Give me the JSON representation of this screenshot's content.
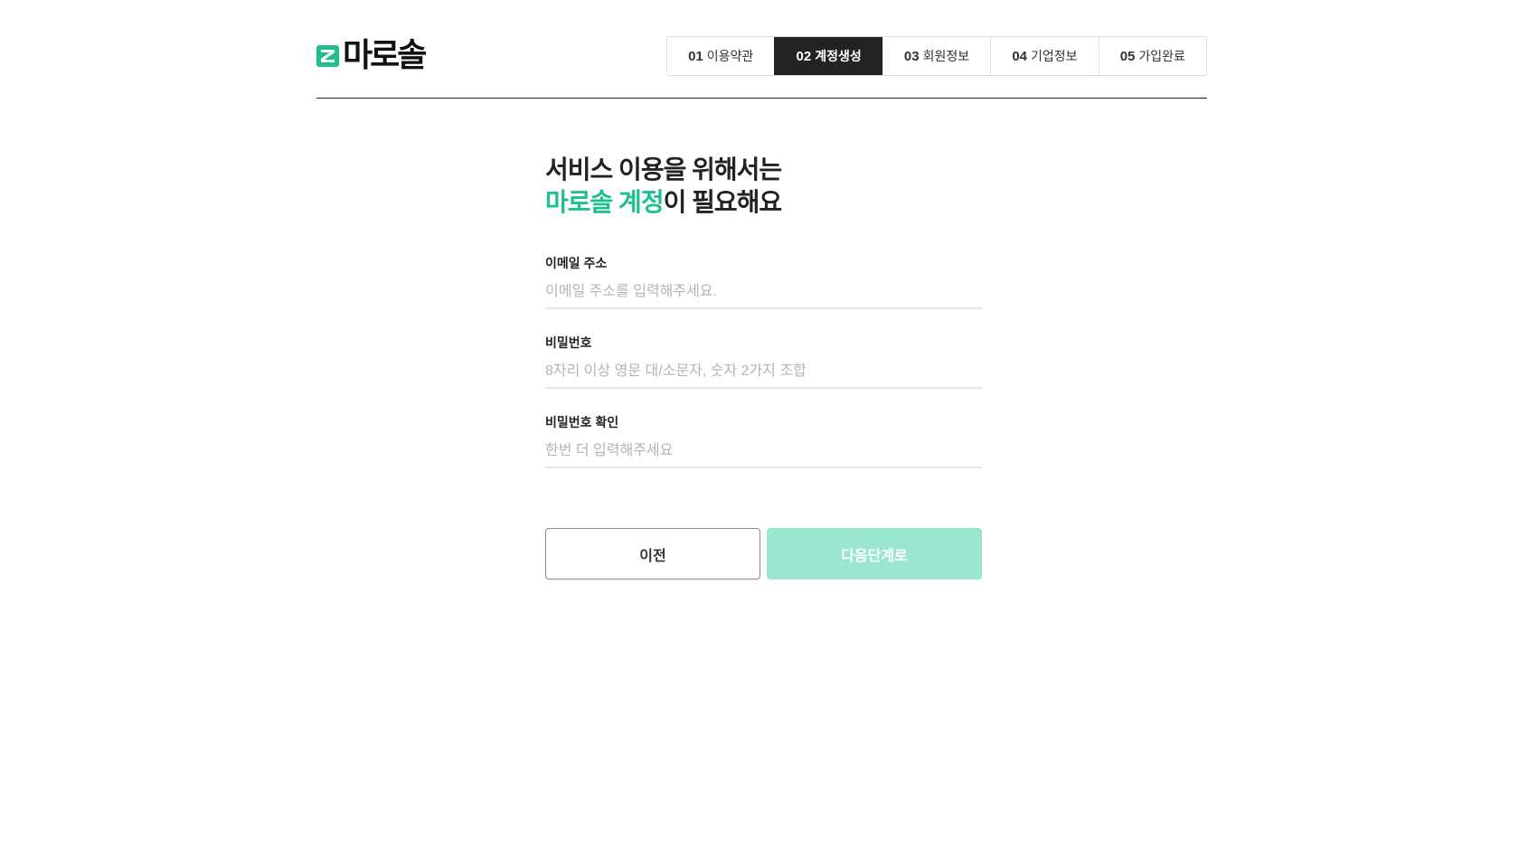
{
  "logo": {
    "text": "마로솔"
  },
  "steps": [
    {
      "num": "01",
      "label": "이용약관",
      "active": false
    },
    {
      "num": "02",
      "label": "계정생성",
      "active": true
    },
    {
      "num": "03",
      "label": "회원정보",
      "active": false
    },
    {
      "num": "04",
      "label": "기업정보",
      "active": false
    },
    {
      "num": "05",
      "label": "가입완료",
      "active": false
    }
  ],
  "headline": {
    "line1": "서비스 이용을 위해서는",
    "line2_accent": "마로솔 계정",
    "line2_rest": "이 필요해요"
  },
  "form": {
    "email": {
      "label": "이메일 주소",
      "placeholder": "이메일 주소를 입력해주세요.",
      "value": ""
    },
    "password": {
      "label": "비밀번호",
      "placeholder": "8자리 이상 영문 대/소문자, 숫자 2가지 조합",
      "value": ""
    },
    "password_confirm": {
      "label": "비밀번호 확인",
      "placeholder": "한번 더 입력해주세요",
      "value": ""
    }
  },
  "buttons": {
    "prev": "이전",
    "next": "다음단계로"
  },
  "colors": {
    "accent": "#1fbf8f",
    "next_button_disabled": "#9be6d0",
    "active_step": "#222222"
  }
}
